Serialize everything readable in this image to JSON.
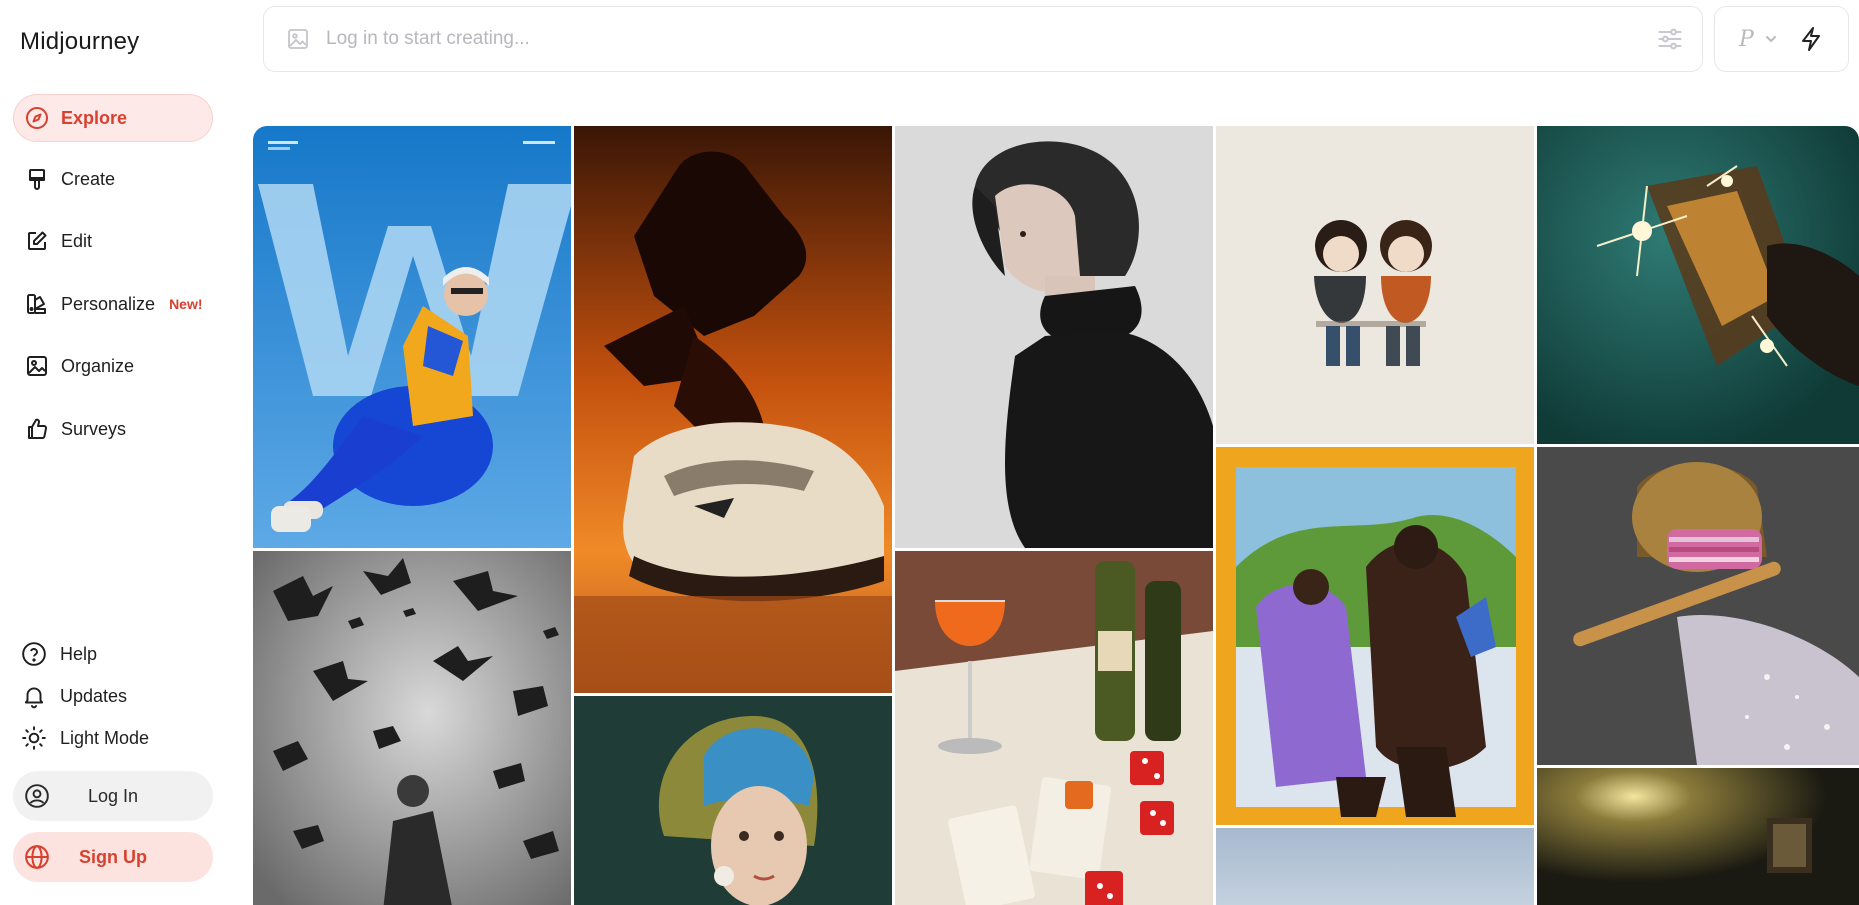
{
  "app": {
    "name": "Midjourney"
  },
  "nav": {
    "items": [
      {
        "label": "Explore",
        "icon": "compass-icon",
        "active": true
      },
      {
        "label": "Create",
        "icon": "paintbrush-icon"
      },
      {
        "label": "Edit",
        "icon": "pencil-square-icon"
      },
      {
        "label": "Personalize",
        "icon": "palette-icon",
        "badge": "New!"
      },
      {
        "label": "Organize",
        "icon": "image-frame-icon"
      },
      {
        "label": "Surveys",
        "icon": "thumbs-up-icon"
      }
    ]
  },
  "utility": {
    "help": "Help",
    "updates": "Updates",
    "theme": "Light Mode"
  },
  "auth": {
    "login": "Log In",
    "signup": "Sign Up"
  },
  "prompt": {
    "placeholder": "Log in to start creating..."
  },
  "mode": {
    "letter": "P"
  },
  "colors": {
    "accent": "#d8402f",
    "accent_bg": "#fde9e7",
    "neutral_bg": "#f1f1f2"
  },
  "gallery": {
    "images": [
      {
        "name": "man-in-blue-chair-image"
      },
      {
        "name": "pigeons-flying-bw-image"
      },
      {
        "name": "running-shoe-silhouette-image"
      },
      {
        "name": "knitted-pearl-earring-girl-image"
      },
      {
        "name": "woman-black-turtleneck-image"
      },
      {
        "name": "drinks-cards-dice-still-life-image"
      },
      {
        "name": "two-kids-sitting-sketch-image"
      },
      {
        "name": "crayon-two-figures-image"
      },
      {
        "name": "blue-sky-partial-image"
      },
      {
        "name": "sparkling-glass-image"
      },
      {
        "name": "robot-playing-flute-image"
      },
      {
        "name": "dim-room-lamp-image"
      }
    ]
  }
}
